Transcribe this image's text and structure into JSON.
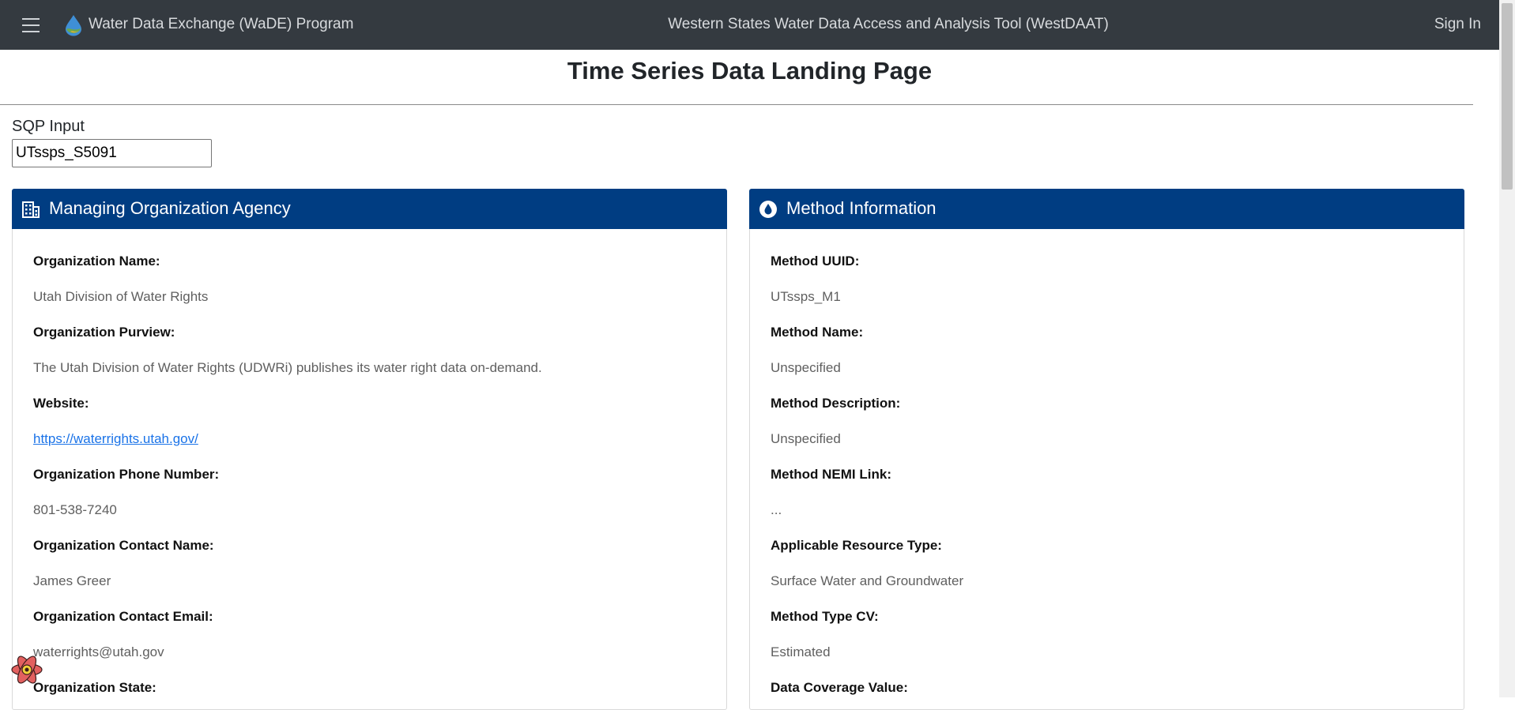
{
  "navbar": {
    "brand": "Water Data Exchange (WaDE) Program",
    "app_title": "Western States Water Data Access and Analysis Tool (WestDAAT)",
    "sign_in": "Sign In"
  },
  "page": {
    "title": "Time Series Data Landing Page"
  },
  "sqp": {
    "label": "SQP Input",
    "value": "UTssps_S5091"
  },
  "organization_card": {
    "title": "Managing Organization Agency",
    "icon": "building-icon",
    "fields": [
      {
        "label": "Organization Name:",
        "value": "Utah Division of Water Rights"
      },
      {
        "label": "Organization Purview:",
        "value": "The Utah Division of Water Rights (UDWRi) publishes its water right data on-demand."
      },
      {
        "label": "Website:",
        "value": "https://waterrights.utah.gov/"
      },
      {
        "label": "Organization Phone Number:",
        "value": "801-538-7240"
      },
      {
        "label": "Organization Contact Name:",
        "value": "James Greer"
      },
      {
        "label": "Organization Contact Email:",
        "value": "waterrights@utah.gov"
      },
      {
        "label": "Organization State:",
        "value": ""
      }
    ]
  },
  "method_card": {
    "title": "Method Information",
    "icon": "water-drop-icon",
    "fields": [
      {
        "label": "Method UUID:",
        "value": "UTssps_M1"
      },
      {
        "label": "Method Name:",
        "value": "Unspecified"
      },
      {
        "label": "Method Description:",
        "value": "Unspecified"
      },
      {
        "label": "Method NEMI Link:",
        "value": "..."
      },
      {
        "label": "Applicable Resource Type:",
        "value": "Surface Water and Groundwater"
      },
      {
        "label": "Method Type CV:",
        "value": "Estimated"
      },
      {
        "label": "Data Coverage Value:",
        "value": ""
      }
    ]
  },
  "colors": {
    "navbar_bg": "#343a40",
    "card_header_bg": "#003d82",
    "link": "#1a73e8"
  }
}
